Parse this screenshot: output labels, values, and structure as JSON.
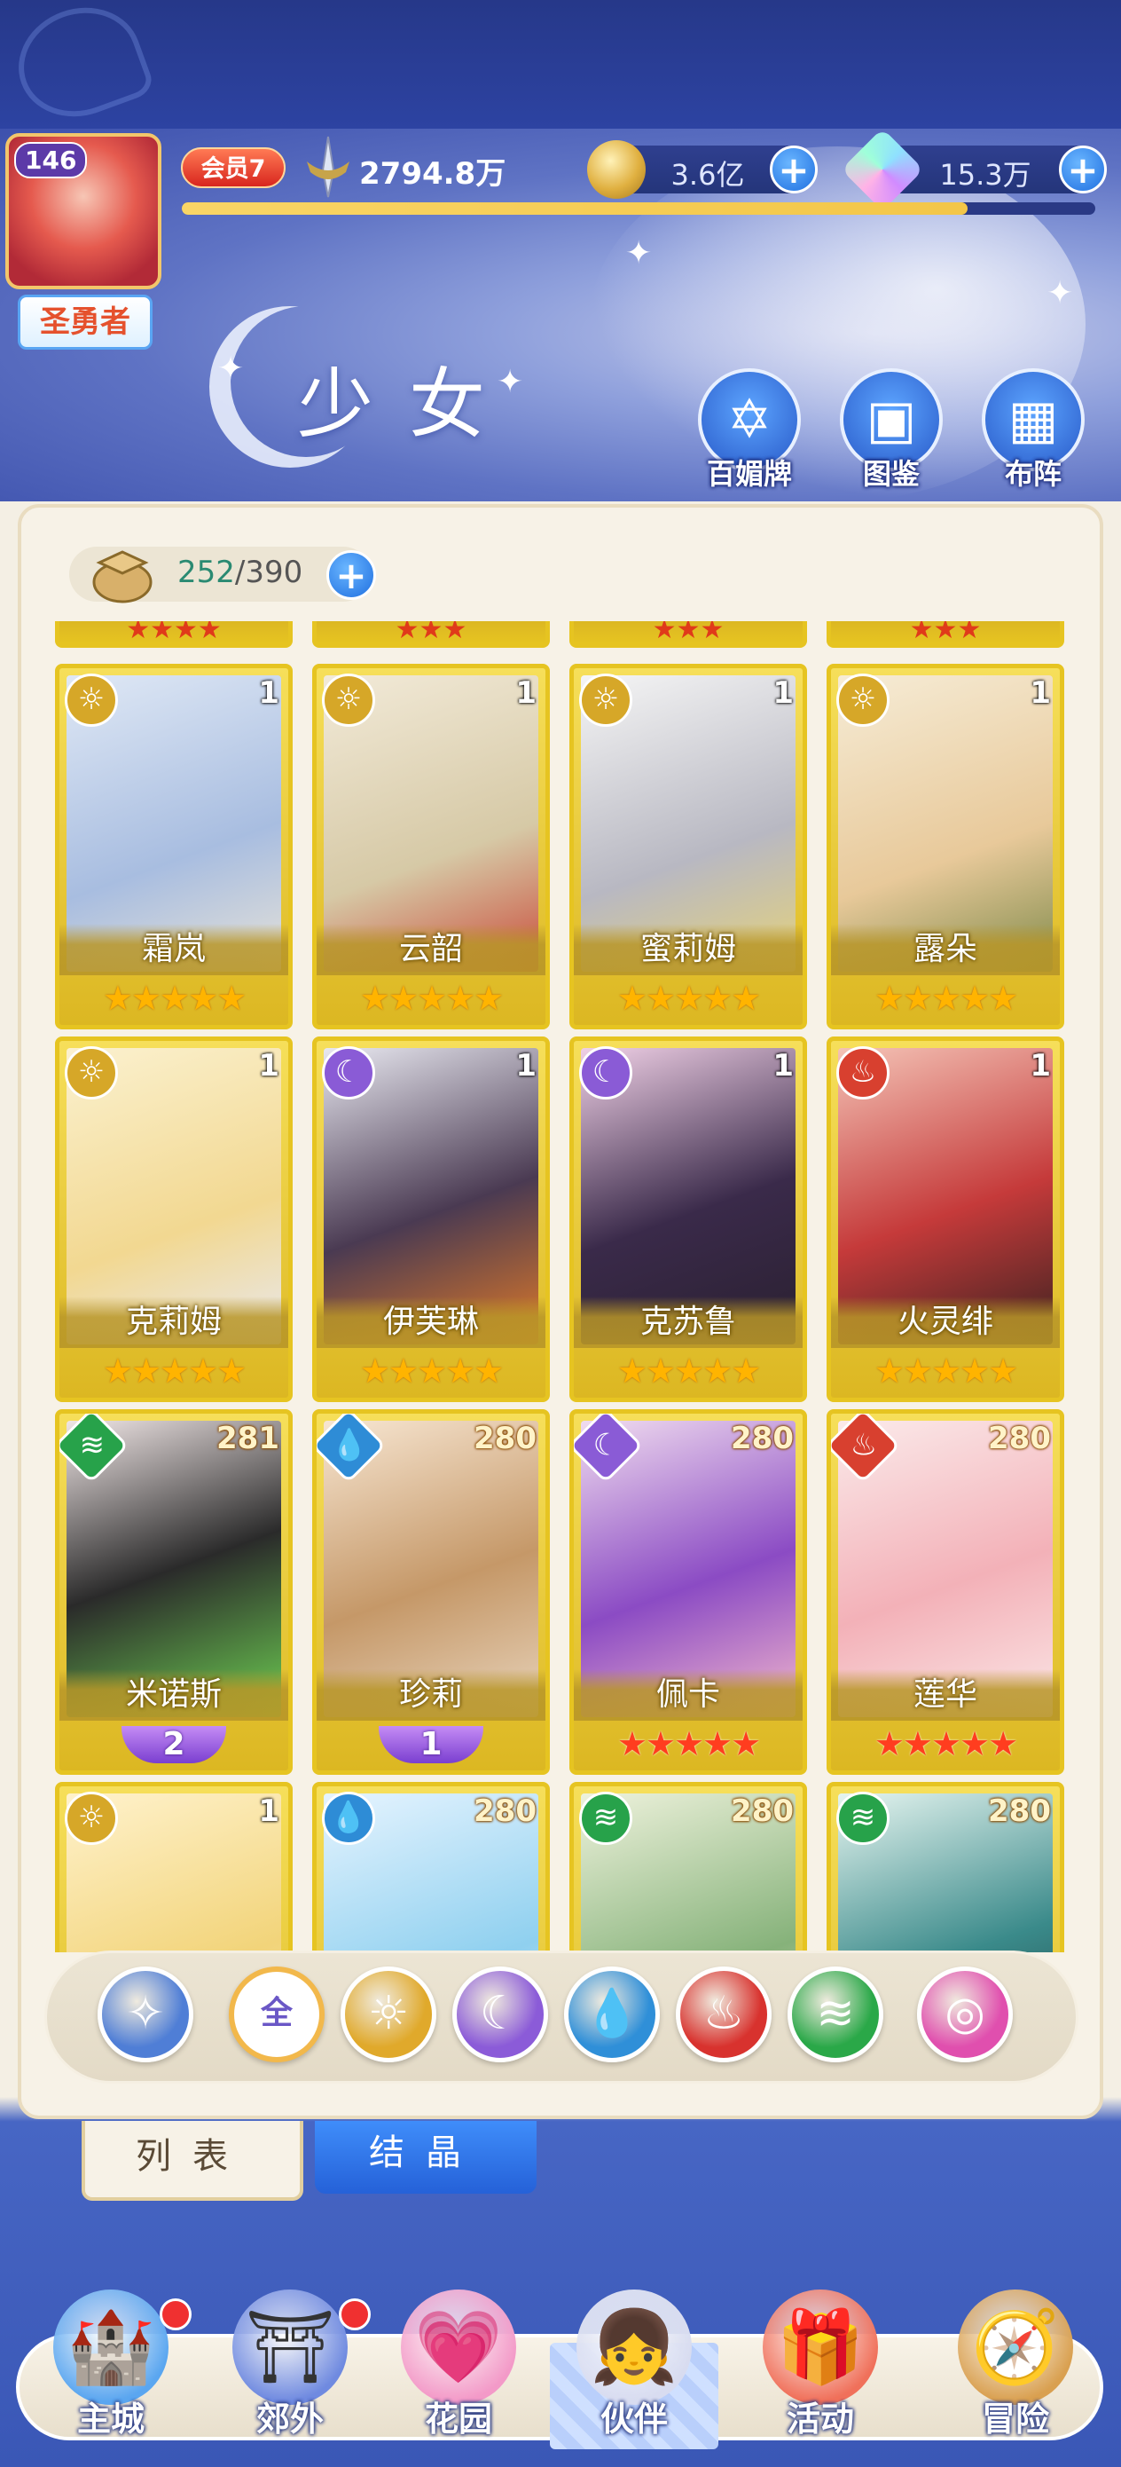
{
  "header": {
    "level": "146",
    "rank": "圣勇者",
    "vip": "会员7",
    "power": "2794.8万",
    "gold": "3.6亿",
    "gems": "15.3万",
    "exp_fraction": 0.86
  },
  "banner": {
    "title": "少女",
    "quick": [
      {
        "label": "百媚牌",
        "icon": "card-deck-icon"
      },
      {
        "label": "图鉴",
        "icon": "book-icon"
      },
      {
        "label": "布阵",
        "icon": "grid-icon"
      }
    ]
  },
  "roster": {
    "current": "252",
    "max": "/390"
  },
  "cards": [
    {
      "name": "霜岚",
      "count": "1",
      "element": "light",
      "stars": "★★★★★",
      "star_color": "gold"
    },
    {
      "name": "云韶",
      "count": "1",
      "element": "light",
      "stars": "★★★★★",
      "star_color": "gold"
    },
    {
      "name": "蜜莉姆",
      "count": "1",
      "element": "light",
      "stars": "★★★★★",
      "star_color": "gold"
    },
    {
      "name": "露朵",
      "count": "1",
      "element": "light",
      "stars": "★★★★★",
      "star_color": "gold"
    },
    {
      "name": "克莉姆",
      "count": "1",
      "element": "light",
      "stars": "★★★★★",
      "star_color": "gold"
    },
    {
      "name": "伊芙琳",
      "count": "1",
      "element": "dark",
      "stars": "★★★★★",
      "star_color": "gold"
    },
    {
      "name": "克苏鲁",
      "count": "1",
      "element": "dark",
      "stars": "★★★★★",
      "star_color": "gold"
    },
    {
      "name": "火灵绯",
      "count": "1",
      "element": "fire",
      "stars": "★★★★★",
      "star_color": "gold"
    },
    {
      "name": "米诺斯",
      "count": "281",
      "element": "wind",
      "awaken": "2"
    },
    {
      "name": "珍莉",
      "count": "280",
      "element": "water",
      "awaken": "1"
    },
    {
      "name": "佩卡",
      "count": "280",
      "element": "dark",
      "stars": "★★★★★",
      "star_color": "red"
    },
    {
      "name": "莲华",
      "count": "280",
      "element": "fire",
      "stars": "★★★★★",
      "star_color": "red"
    },
    {
      "name": "",
      "count": "1",
      "element": "light"
    },
    {
      "name": "",
      "count": "280",
      "element": "water"
    },
    {
      "name": "",
      "count": "280",
      "element": "wind"
    },
    {
      "name": "",
      "count": "280",
      "element": "wind"
    }
  ],
  "filters": [
    {
      "id": "special",
      "icon": "wing-star-icon",
      "color": "#4f7ed6"
    },
    {
      "id": "all",
      "label": "全",
      "color": "#ffffff"
    },
    {
      "id": "light",
      "icon": "sun-icon",
      "color": "#e0a92b"
    },
    {
      "id": "dark",
      "icon": "moon-icon",
      "color": "#8b5bd8"
    },
    {
      "id": "water",
      "icon": "water-drop-icon",
      "color": "#2f8fd8"
    },
    {
      "id": "fire",
      "icon": "flame-icon",
      "color": "#d8322e"
    },
    {
      "id": "wind",
      "icon": "wind-icon",
      "color": "#2aa848"
    },
    {
      "id": "chaos",
      "icon": "orbit-icon",
      "color": "#e04fae"
    }
  ],
  "tabs": {
    "list": "列表",
    "crystal": "结晶"
  },
  "nav": [
    {
      "label": "主城",
      "icon": "castle-icon",
      "dot": true
    },
    {
      "label": "郊外",
      "icon": "gate-icon",
      "dot": true
    },
    {
      "label": "花园",
      "icon": "heart-icon",
      "dot": false
    },
    {
      "label": "伙伴",
      "icon": "partner-icon",
      "dot": false,
      "active": true
    },
    {
      "label": "活动",
      "icon": "gift-icon",
      "dot": false
    },
    {
      "label": "冒险",
      "icon": "compass-icon",
      "dot": false
    }
  ],
  "colors": {
    "light": "#d6a728",
    "dark": "#8a5bd6",
    "fire": "#d8402f",
    "water": "#2e8cd6",
    "wind": "#27a24a"
  }
}
